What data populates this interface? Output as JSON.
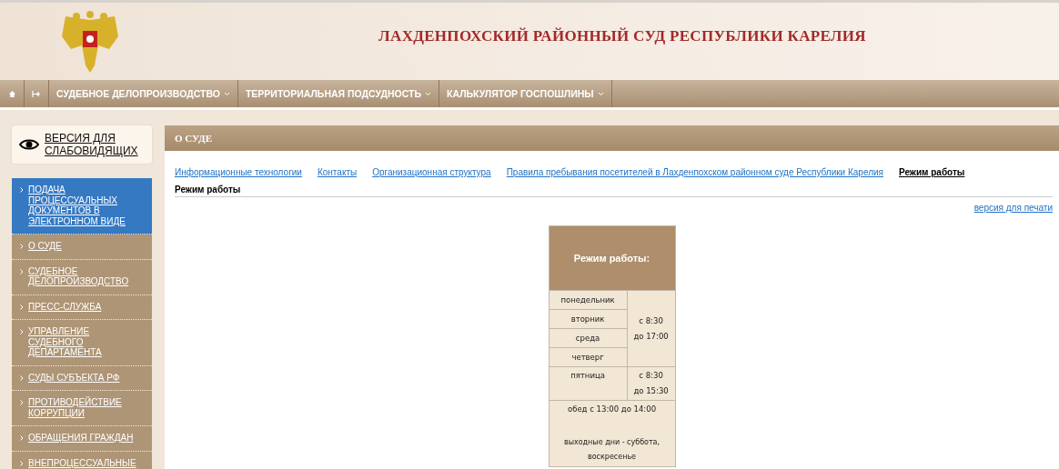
{
  "header": {
    "title": "ЛАХДЕНПОХСКИЙ РАЙОННЫЙ СУД РЕСПУБЛИКИ КАРЕЛИЯ"
  },
  "nav": [
    {
      "kind": "home"
    },
    {
      "kind": "sitemap"
    },
    {
      "kind": "menu",
      "label": "СУДЕБНОЕ ДЕЛОПРОИЗВОДСТВО",
      "dropdown": true
    },
    {
      "kind": "menu",
      "label": "ТЕРРИТОРИАЛЬНАЯ ПОДСУДНОСТЬ",
      "dropdown": true
    },
    {
      "kind": "menu",
      "label": "КАЛЬКУЛЯТОР ГОСПОШЛИНЫ",
      "dropdown": true
    }
  ],
  "accessibility": {
    "label": "ВЕРСИЯ ДЛЯ СЛАБОВИДЯЩИХ"
  },
  "sidebar": {
    "items": [
      {
        "label": "ПОДАЧА ПРОЦЕССУАЛЬНЫХ ДОКУМЕНТОВ В ЭЛЕКТРОННОМ ВИДЕ",
        "selected": true
      },
      {
        "label": "О СУДЕ",
        "selected": false
      },
      {
        "label": "СУДЕБНОЕ ДЕЛОПРОИЗВОДСТВО",
        "selected": false
      },
      {
        "label": "ПРЕСС-СЛУЖБА",
        "selected": false
      },
      {
        "label": "УПРАВЛЕНИЕ СУДЕБНОГО ДЕПАРТАМЕНТА",
        "selected": false
      },
      {
        "label": "СУДЫ СУБЪЕКТА РФ",
        "selected": false
      },
      {
        "label": "ПРОТИВОДЕЙСТВИЕ КОРРУПЦИИ",
        "selected": false
      },
      {
        "label": "ОБРАЩЕНИЯ ГРАЖДАН",
        "selected": false
      },
      {
        "label": "ВНЕПРОЦЕССУАЛЬНЫЕ",
        "selected": false
      }
    ]
  },
  "section": {
    "title": "О СУДЕ"
  },
  "tabs": [
    {
      "label": "Информационные технологии",
      "selected": false
    },
    {
      "label": "Контакты",
      "selected": false
    },
    {
      "label": "Организационная структура",
      "selected": false
    },
    {
      "label": "Правила пребывания посетителей в Лахденпохском районном суде Республики Карелия",
      "selected": false
    },
    {
      "label": "Режим работы",
      "selected": true
    }
  ],
  "page_heading": "Режим работы",
  "print_link": "версия для печати",
  "schedule": {
    "title": "Режим работы:",
    "groups": [
      {
        "days": [
          "понедельник",
          "вторник",
          "среда",
          "четверг"
        ],
        "hours": [
          "с 8:30",
          "до 17:00"
        ]
      },
      {
        "days": [
          "пятница"
        ],
        "hours": [
          "с 8:30",
          "до 15:30"
        ]
      }
    ],
    "lunch": "обед с 13:00 до 14:00",
    "weekend": "выходные дни - суббота, воскресенье"
  }
}
